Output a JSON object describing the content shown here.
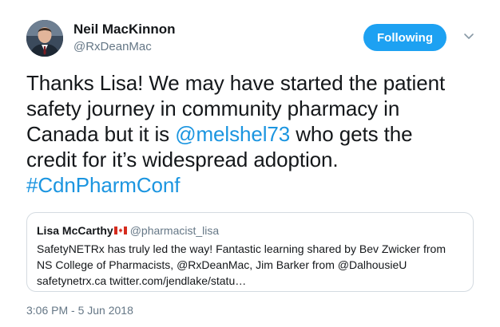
{
  "author": {
    "display_name": "Neil MacKinnon",
    "handle": "@RxDeanMac",
    "avatar_icon": "profile-photo"
  },
  "follow_button": {
    "label": "Following",
    "color": "#1da1f2"
  },
  "menu": {
    "icon": "chevron-down-icon"
  },
  "tweet": {
    "line1": "Thanks Lisa! We may have started the patient",
    "line2": "safety journey in community pharmacy in",
    "line3_pre": "Canada but it is ",
    "mention": "@melshel73",
    "line3_post": " who gets the",
    "line4": "credit for it’s widespread adoption.",
    "hashtag": "#CdnPharmConf",
    "link_color": "#1b95e0"
  },
  "quoted_tweet": {
    "display_name": "Lisa McCarthy",
    "flag_icon": "canada-flag-icon",
    "handle": "@pharmacist_lisa",
    "line1": "SafetyNETRx has truly led the way! Fantastic learning shared by Bev Zwicker from",
    "line2": "NS College of Pharmacists, @RxDeanMac, Jim Barker from @DalhousieU",
    "line3": "safetynetrx.ca twitter.com/jendlake/statu…"
  },
  "timestamp": "3:06 PM - 5 Jun 2018"
}
